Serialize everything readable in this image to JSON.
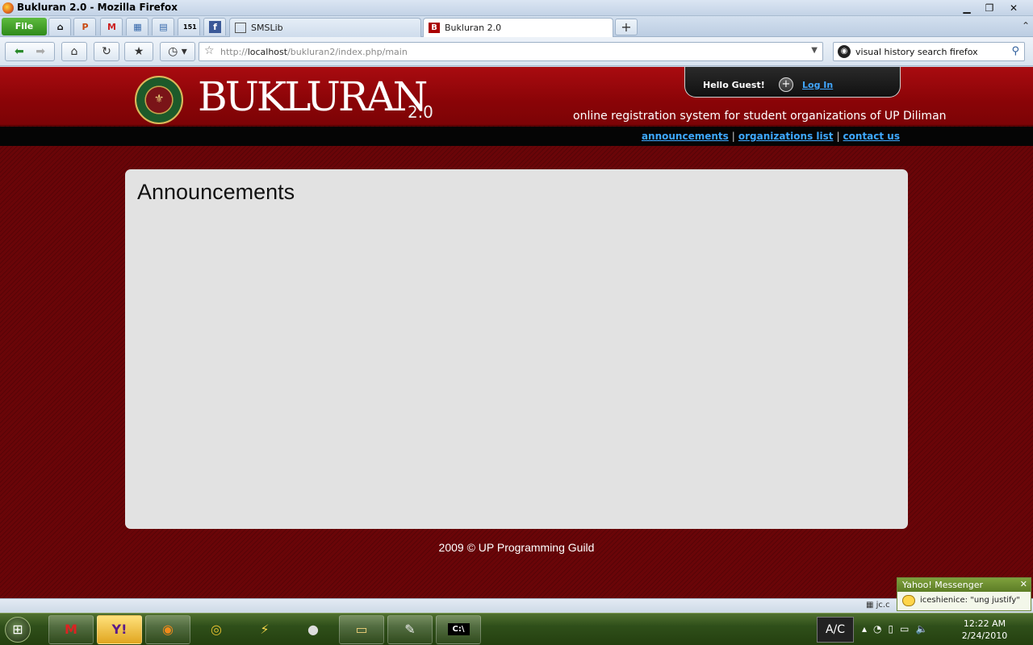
{
  "window": {
    "title": "Bukluran 2.0 - Mozilla Firefox"
  },
  "tabstrip": {
    "file_label": "File",
    "app_tabs": [
      {
        "icon": "home-icon",
        "glyph": "⌂"
      },
      {
        "icon": "p-app-icon",
        "glyph": "P"
      },
      {
        "icon": "gmail-icon",
        "glyph": "M"
      },
      {
        "icon": "calendar-icon",
        "glyph": "▦"
      },
      {
        "icon": "document-icon",
        "glyph": "▤"
      },
      {
        "icon": "151-icon",
        "glyph": "151"
      },
      {
        "icon": "facebook-icon",
        "glyph": "f"
      }
    ],
    "tabs": [
      {
        "label": "SMSLib",
        "icon": "mail-icon"
      },
      {
        "label": "Bukluran 2.0",
        "icon": "bukluran-favicon-icon"
      }
    ],
    "new_tab_label": "+"
  },
  "navbar": {
    "url_domain": "localhost",
    "url_prefix": "http://",
    "url_path": "/bukluran2/index.php/main",
    "search_query": "visual history search firefox"
  },
  "site": {
    "brand": "BUKLURAN",
    "version": "2.0",
    "tagline": "online registration system for student organizations of UP Diliman",
    "greeting": "Hello Guest!",
    "login_label": "Log In",
    "nav_links": [
      "announcements",
      "organizations list",
      "contact us"
    ],
    "separator": "|",
    "panel_title": "Announcements",
    "footer": "2009 © UP Programming Guild"
  },
  "statusbar": {
    "text": "jc.c"
  },
  "yahoo_popup": {
    "title": "Yahoo! Messenger",
    "message": "iceshienice:  \"ung justify\""
  },
  "taskbar": {
    "ac_label": "A/C",
    "time": "12:22 AM",
    "date": "2/24/2010",
    "buttons": [
      {
        "icon": "gmail-icon",
        "glyph": "M"
      },
      {
        "icon": "yahoo-messenger-icon",
        "glyph": "Y!"
      },
      {
        "icon": "firefox-icon",
        "glyph": "◉"
      },
      {
        "icon": "chrome-icon",
        "glyph": "◎"
      },
      {
        "icon": "winamp-icon",
        "glyph": "⚡"
      },
      {
        "icon": "sheep-icon",
        "glyph": "●"
      },
      {
        "icon": "folder-icon",
        "glyph": "▭"
      },
      {
        "icon": "notepad-icon",
        "glyph": "✎"
      },
      {
        "icon": "command-prompt-icon",
        "glyph": "C:\\"
      }
    ]
  }
}
